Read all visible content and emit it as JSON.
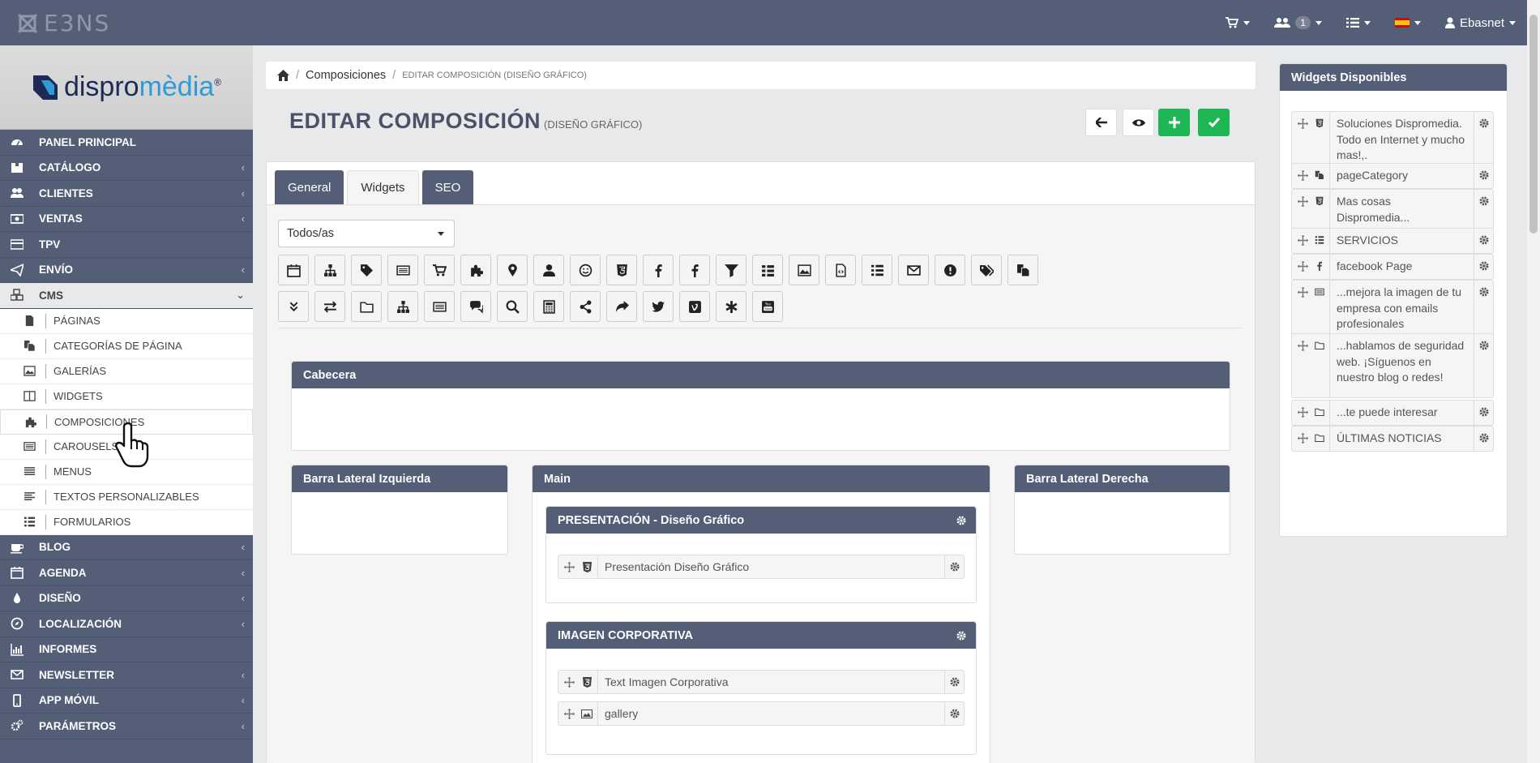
{
  "topbar": {
    "brand": "E3NS",
    "user_count": "1",
    "user_name": "Ebasnet"
  },
  "sidebar": {
    "logo_text_dark": "dispro",
    "logo_text_blue": "mèdia",
    "items_top": [
      {
        "label": "PANEL PRINCIPAL",
        "icon": "dashboard-icon",
        "chevron": false
      },
      {
        "label": "CATÁLOGO",
        "icon": "catalog-icon",
        "chevron": true
      },
      {
        "label": "CLIENTES",
        "icon": "users-icon",
        "chevron": true
      },
      {
        "label": "VENTAS",
        "icon": "money-icon",
        "chevron": true
      },
      {
        "label": "TPV",
        "icon": "credit-card-icon",
        "chevron": false
      },
      {
        "label": "ENVÍO",
        "icon": "paper-plane-icon",
        "chevron": true
      },
      {
        "label": "CMS",
        "icon": "cubes-icon",
        "chevron": true
      }
    ],
    "cms_items": [
      {
        "label": "PÁGINAS",
        "icon": "file-icon"
      },
      {
        "label": "CATEGORÍAS DE PÁGINA",
        "icon": "files-icon"
      },
      {
        "label": "GALERÍAS",
        "icon": "image-icon"
      },
      {
        "label": "WIDGETS",
        "icon": "columns-icon"
      },
      {
        "label": "COMPOSICIONES",
        "icon": "puzzle-icon"
      },
      {
        "label": "CAROUSELS",
        "icon": "carousel-icon"
      },
      {
        "label": "MENUS",
        "icon": "menu-list-icon"
      },
      {
        "label": "TEXTOS PERSONALIZABLES",
        "icon": "align-left-icon"
      },
      {
        "label": "FORMULARIOS",
        "icon": "list-icon"
      }
    ],
    "items_bottom": [
      {
        "label": "BLOG",
        "icon": "coffee-icon",
        "chevron": true
      },
      {
        "label": "AGENDA",
        "icon": "calendar-icon",
        "chevron": true
      },
      {
        "label": "DISEÑO",
        "icon": "tint-icon",
        "chevron": true
      },
      {
        "label": "LOCALIZACIÓN",
        "icon": "compass-icon",
        "chevron": true
      },
      {
        "label": "INFORMES",
        "icon": "bar-chart-icon",
        "chevron": false
      },
      {
        "label": "NEWSLETTER",
        "icon": "envelope-icon",
        "chevron": true
      },
      {
        "label": "APP MÓVIL",
        "icon": "mobile-icon",
        "chevron": true
      },
      {
        "label": "PARÁMETROS",
        "icon": "cogs-icon",
        "chevron": true
      }
    ]
  },
  "breadcrumb": {
    "parent": "Composiciones",
    "current": "EDITAR COMPOSICIÓN (DISEÑO GRÁFICO)"
  },
  "page": {
    "title": "EDITAR COMPOSICIÓN",
    "subtitle": "(DISEÑO GRÁFICO)"
  },
  "tabs": [
    "General",
    "Widgets",
    "SEO"
  ],
  "filter": {
    "selected": "Todos/as"
  },
  "zones": {
    "header": "Cabecera",
    "left": "Barra Lateral Izquierda",
    "main": "Main",
    "right": "Barra Lateral Derecha"
  },
  "main_blocks": [
    {
      "title": "PRESENTACIÓN - Diseño Gráfico",
      "widgets": [
        {
          "label": "Presentación Diseño Gráfico",
          "icon": "html5-icon"
        }
      ]
    },
    {
      "title": "IMAGEN CORPORATIVA",
      "widgets": [
        {
          "label": "Text Imagen Corporativa",
          "icon": "html5-icon"
        },
        {
          "label": "gallery",
          "icon": "image-icon"
        }
      ]
    }
  ],
  "available": {
    "title": "Widgets Disponibles",
    "items": [
      {
        "label": "Soluciones Dispromedia. Todo en Internet y mucho mas!,.",
        "icon": "html5-icon"
      },
      {
        "label": "pageCategory",
        "icon": "files-icon"
      },
      {
        "label": "Mas cosas Dispromedia...",
        "icon": "html5-icon"
      },
      {
        "label": "SERVICIOS",
        "icon": "list-icon"
      },
      {
        "label": "facebook Page",
        "icon": "facebook-icon"
      },
      {
        "label": "...mejora la imagen de tu empresa con emails profesionales",
        "icon": "carousel-icon"
      },
      {
        "label": "...hablamos de seguridad web. ¡Síguenos en nuestro blog o redes!",
        "icon": "folder-icon"
      },
      {
        "label": "...te puede interesar",
        "icon": "folder-icon"
      },
      {
        "label": "ÚLTIMAS NOTICIAS",
        "icon": "folder-icon"
      }
    ]
  },
  "colors": {
    "navy": "#545e77",
    "green": "#1fb656",
    "background": "#e8e9eb"
  }
}
